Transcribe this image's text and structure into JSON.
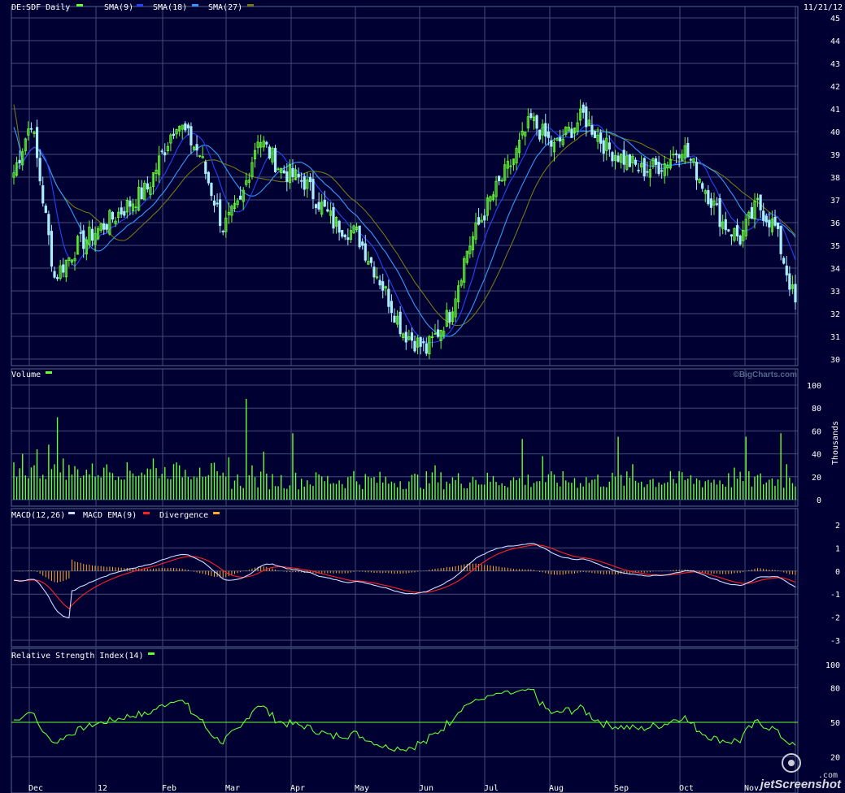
{
  "chart_data": [
    {
      "type": "candlestick",
      "title": "DE:SDF Daily",
      "date": "11/21/12",
      "legend": [
        "DE:SDF Daily",
        "SMA(9)",
        "SMA(18)",
        "SMA(27)"
      ],
      "series_colors": {
        "price": "#66ff33",
        "down": "#aaeeff",
        "sma9": "#2244ff",
        "sma18": "#3399ff",
        "sma27": "#777711"
      },
      "ylim": [
        30,
        45
      ],
      "y_ticks": [
        "45",
        "44",
        "43",
        "42",
        "41",
        "40",
        "39",
        "38",
        "37",
        "36",
        "35",
        "34",
        "33",
        "32",
        "31",
        "30"
      ],
      "anchors": [
        [
          0,
          38.2
        ],
        [
          6,
          40.5
        ],
        [
          14,
          33.6
        ],
        [
          22,
          35.0
        ],
        [
          34,
          36.2
        ],
        [
          46,
          37.5
        ],
        [
          56,
          40.5
        ],
        [
          64,
          39.0
        ],
        [
          72,
          35.8
        ],
        [
          78,
          36.8
        ],
        [
          84,
          39.8
        ],
        [
          92,
          38.3
        ],
        [
          100,
          37.8
        ],
        [
          110,
          36.0
        ],
        [
          118,
          35.5
        ],
        [
          126,
          33.5
        ],
        [
          134,
          31.2
        ],
        [
          142,
          30.4
        ],
        [
          150,
          32.0
        ],
        [
          156,
          34.8
        ],
        [
          164,
          37.0
        ],
        [
          172,
          38.8
        ],
        [
          178,
          40.5
        ],
        [
          186,
          39.3
        ],
        [
          196,
          40.7
        ],
        [
          204,
          39.3
        ],
        [
          216,
          38.3
        ],
        [
          224,
          38.6
        ],
        [
          230,
          39.4
        ],
        [
          236,
          38.0
        ],
        [
          244,
          36.0
        ],
        [
          250,
          35.3
        ],
        [
          256,
          36.8
        ],
        [
          262,
          35.8
        ],
        [
          269,
          32.4
        ]
      ]
    },
    {
      "type": "bar",
      "title": "Volume",
      "ylabel": "Thousands",
      "ylim": [
        0,
        100
      ],
      "y_ticks": [
        "100",
        "80",
        "60",
        "40",
        "20",
        "0"
      ],
      "base_volume": 9,
      "volume_spikes": [
        [
          3,
          40
        ],
        [
          8,
          44
        ],
        [
          12,
          48
        ],
        [
          15,
          72
        ],
        [
          17,
          36
        ],
        [
          31,
          28
        ],
        [
          48,
          36
        ],
        [
          57,
          30
        ],
        [
          64,
          28
        ],
        [
          74,
          37
        ],
        [
          80,
          88
        ],
        [
          82,
          30
        ],
        [
          86,
          42
        ],
        [
          96,
          58
        ],
        [
          105,
          22
        ],
        [
          117,
          25
        ],
        [
          129,
          14
        ],
        [
          145,
          30
        ],
        [
          158,
          20
        ],
        [
          175,
          53
        ],
        [
          182,
          38
        ],
        [
          208,
          55
        ],
        [
          213,
          31
        ],
        [
          226,
          25
        ],
        [
          248,
          28
        ],
        [
          252,
          55
        ],
        [
          264,
          58
        ],
        [
          266,
          31
        ]
      ],
      "copyright": "©BigCharts.com"
    },
    {
      "type": "line",
      "title": "MACD",
      "legend": [
        "MACD(12,26)",
        "MACD EMA(9)",
        "Divergence"
      ],
      "series_colors": {
        "macd": "#ccddff",
        "ema": "#ff2222",
        "divergence": "#ffaa22"
      },
      "ylim": [
        -3,
        2
      ],
      "y_ticks": [
        "2",
        "1",
        "0",
        "-1",
        "-2",
        "-3"
      ]
    },
    {
      "type": "line",
      "title": "Relative Strength Index(14)",
      "series_colors": {
        "rsi": "#66ff33",
        "midline": "#66ff33"
      },
      "ylim": [
        0,
        100
      ],
      "midline": 50,
      "y_ticks": [
        "100",
        "80",
        "50",
        "20"
      ]
    }
  ],
  "x_labels": [
    "Dec",
    "12",
    "Feb",
    "Mar",
    "Apr",
    "May",
    "Jun",
    "Jul",
    "Aug",
    "Sep",
    "Oct",
    "Nov"
  ],
  "watermark": "jetScreenshot",
  "watermark_suffix": ".com"
}
